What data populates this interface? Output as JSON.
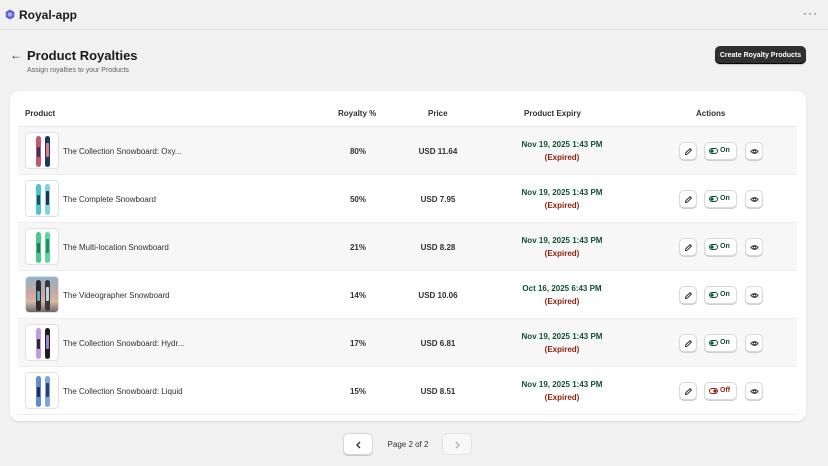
{
  "app": {
    "title": "Royal-app",
    "menu_label": "···"
  },
  "header": {
    "title": "Product Royalties",
    "subtitle": "Assign royalties to your Products",
    "primary_action": "Create Royalty Products"
  },
  "table": {
    "columns": [
      "Product",
      "Royalty %",
      "Price",
      "Product Expiry",
      "Actions"
    ],
    "rows": [
      {
        "name": "The Collection Snowboard: Oxy...",
        "royalty": "80%",
        "price": "USD 11.64",
        "expiry": "Nov 19, 2025 1:43 PM",
        "status": "(Expired)",
        "toggle": "On"
      },
      {
        "name": "The Complete Snowboard",
        "royalty": "50%",
        "price": "USD 7.95",
        "expiry": "Nov 19, 2025 1:43 PM",
        "status": "(Expired)",
        "toggle": "On"
      },
      {
        "name": "The Multi-location Snowboard",
        "royalty": "21%",
        "price": "USD 8.28",
        "expiry": "Nov 19, 2025 1:43 PM",
        "status": "(Expired)",
        "toggle": "On"
      },
      {
        "name": "The Videographer Snowboard",
        "royalty": "14%",
        "price": "USD 10.06",
        "expiry": "Oct 16, 2025 6:43 PM",
        "status": "(Expired)",
        "toggle": "On"
      },
      {
        "name": "The Collection Snowboard: Hydr...",
        "royalty": "17%",
        "price": "USD 6.81",
        "expiry": "Nov 19, 2025 1:43 PM",
        "status": "(Expired)",
        "toggle": "On"
      },
      {
        "name": "The Collection Snowboard: Liquid",
        "royalty": "15%",
        "price": "USD 8.51",
        "expiry": "Nov 19, 2025 1:43 PM",
        "status": "(Expired)",
        "toggle": "Off"
      }
    ]
  },
  "pagination": {
    "label": "Page 2 of 2"
  },
  "colors": {
    "accent_dark": "#303030",
    "on_green": "#0c5132",
    "expired_red": "#8e1f0b",
    "background": "#f1f1f1"
  },
  "icons": [
    "app-logo-icon",
    "more-icon",
    "back-arrow-icon",
    "edit-icon",
    "toggle-on-icon",
    "toggle-off-icon",
    "view-icon",
    "chevron-left-icon",
    "chevron-right-icon"
  ]
}
